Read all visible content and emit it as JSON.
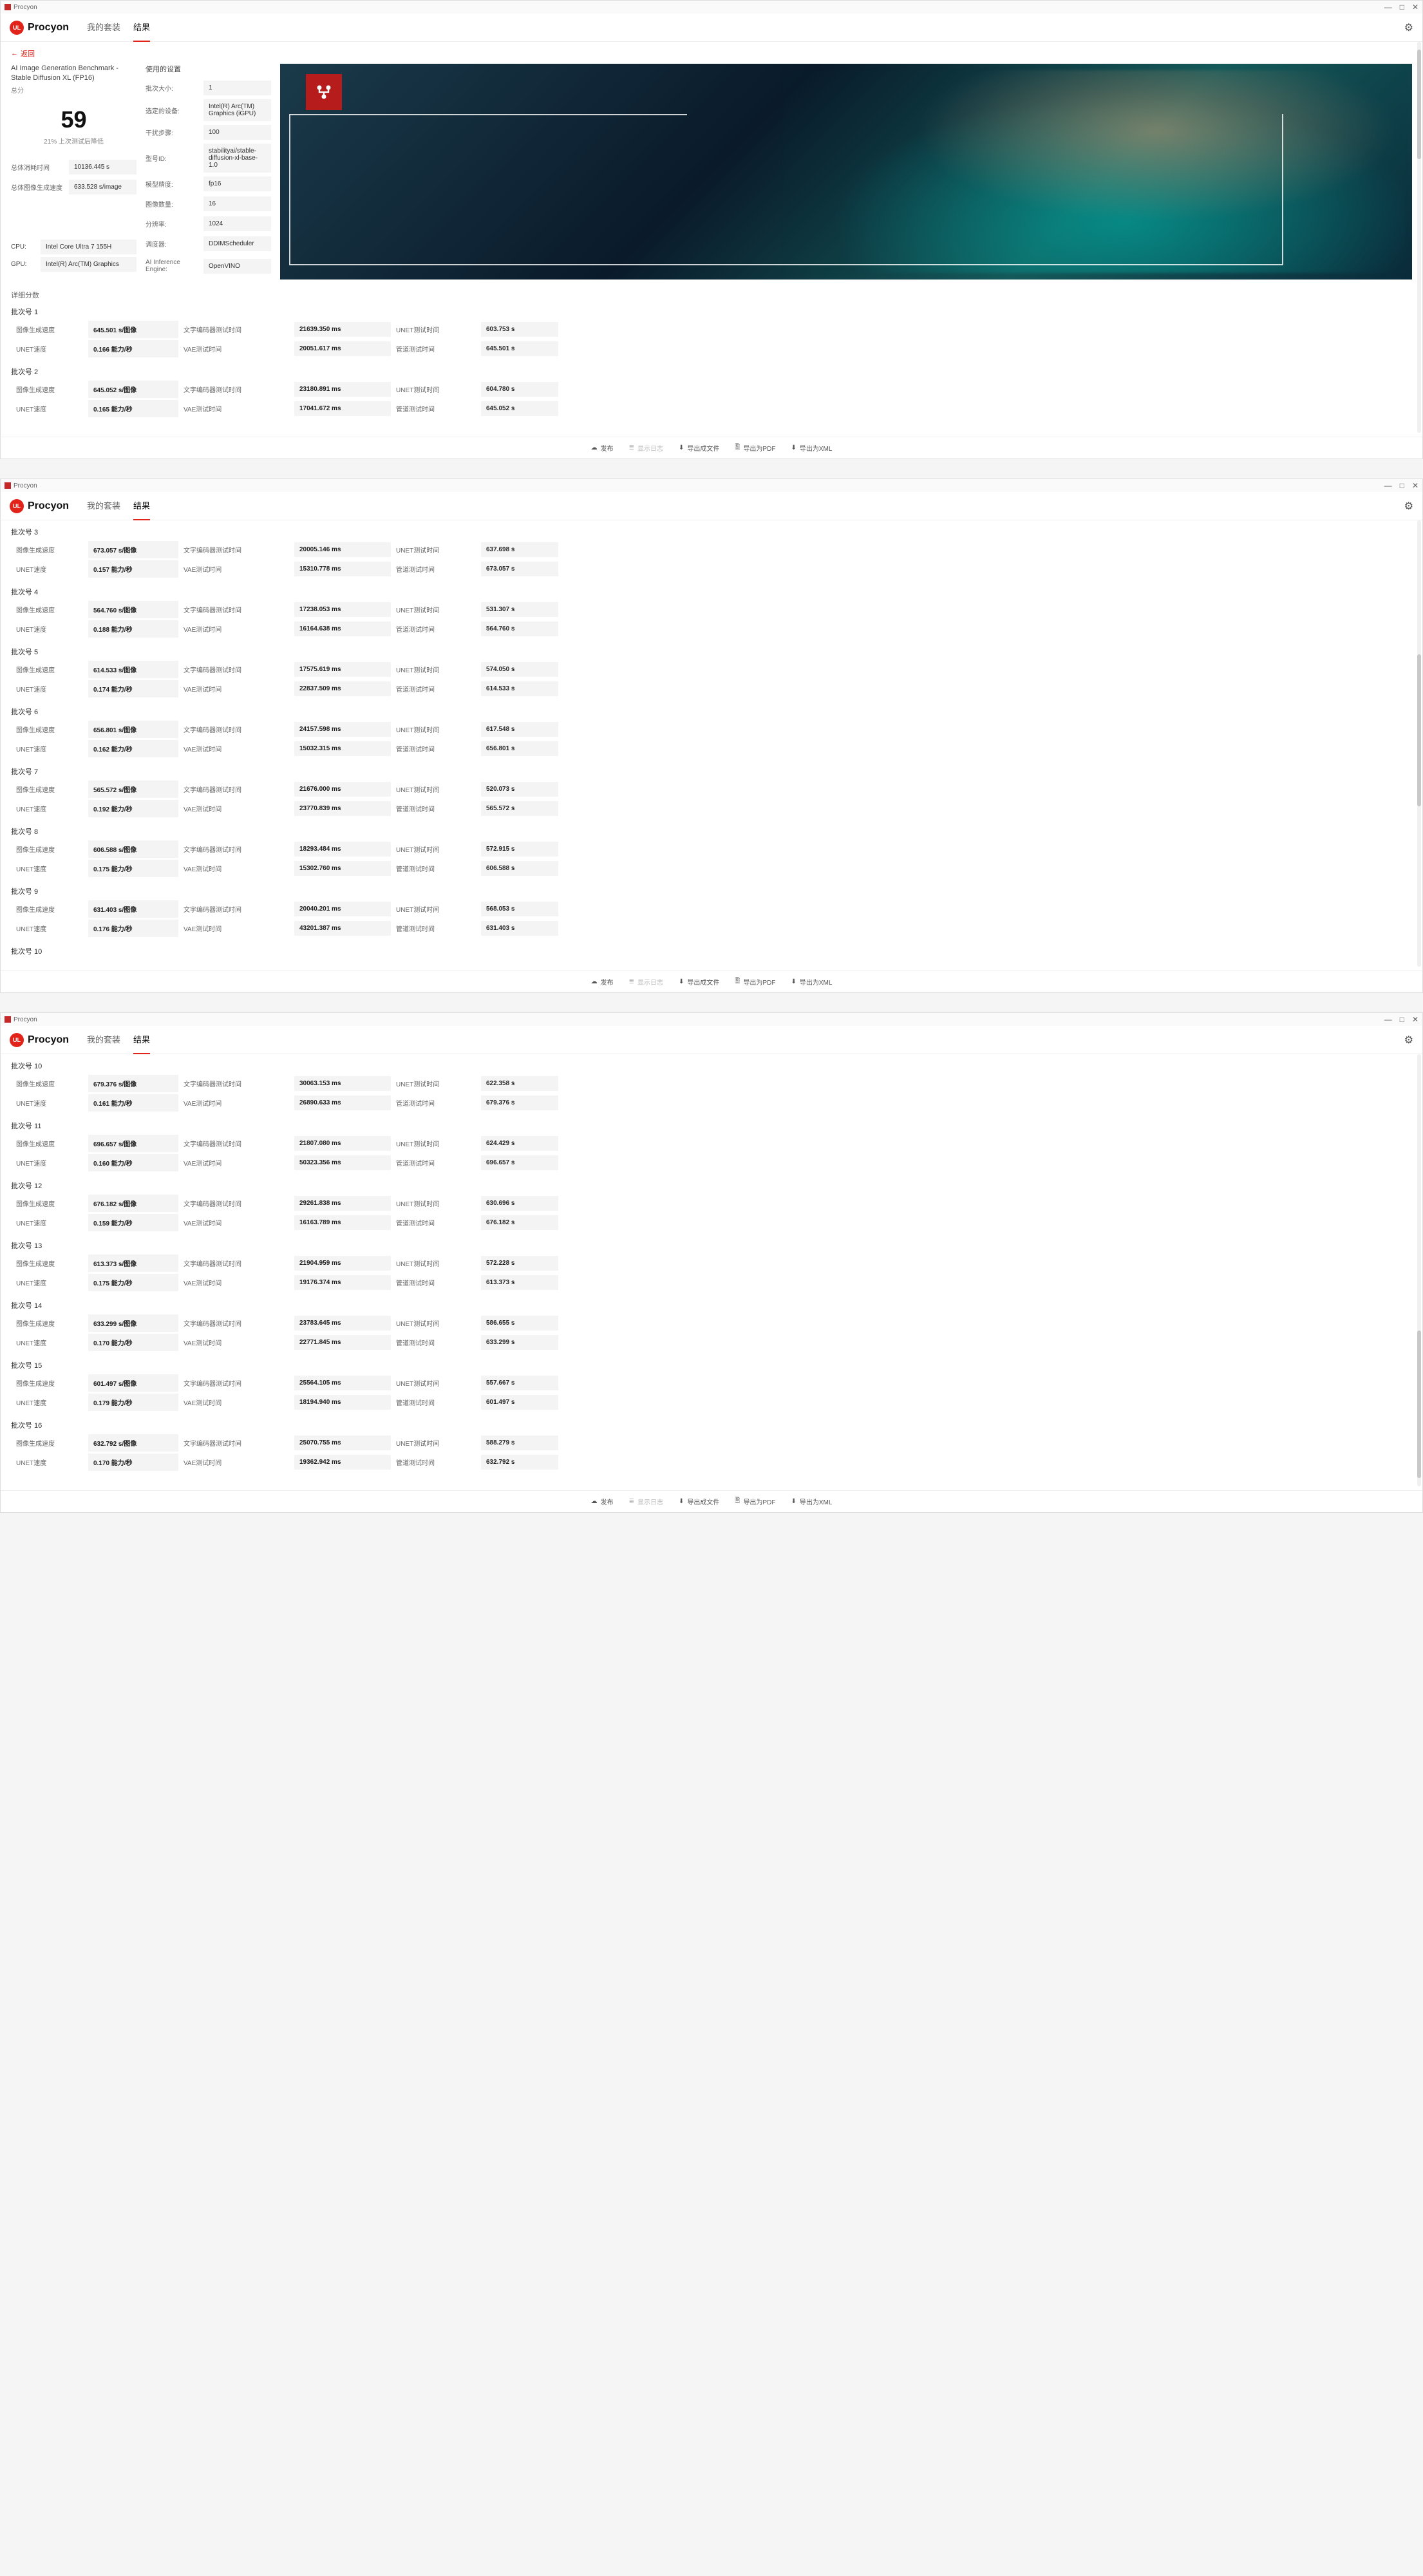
{
  "app": {
    "titlebar": "Procyon",
    "name": "Procyon",
    "logo_badge": "UL"
  },
  "tabs": {
    "my_suites": "我的套装",
    "results": "结果"
  },
  "back": "返回",
  "score": {
    "title": "AI Image Generation Benchmark - Stable Diffusion XL (FP16)",
    "subtitle": "总分",
    "value": "59",
    "note": "21% 上次测试后降低",
    "metrics": [
      {
        "label": "总体消耗时间",
        "value": "10136.445 s"
      },
      {
        "label": "总体图像生成速度",
        "value": "633.528 s/image"
      }
    ],
    "system": [
      {
        "label": "CPU:",
        "value": "Intel Core Ultra 7 155H"
      },
      {
        "label": "GPU:",
        "value": "Intel(R) Arc(TM) Graphics"
      }
    ]
  },
  "settings": {
    "title": "使用的设置",
    "rows": [
      {
        "label": "批次大小:",
        "value": "1"
      },
      {
        "label": "选定的设备:",
        "value": "Intel(R) Arc(TM) Graphics (iGPU)"
      },
      {
        "label": "干扰步骤:",
        "value": "100"
      },
      {
        "label": "型号ID:",
        "value": "stabilityai/stable-diffusion-xl-base-1.0"
      },
      {
        "label": "模型精度:",
        "value": "fp16"
      },
      {
        "label": "图像数量:",
        "value": "16"
      },
      {
        "label": "分辨率:",
        "value": "1024"
      },
      {
        "label": "调度器:",
        "value": "DDIMScheduler"
      },
      {
        "label": "AI Inference Engine:",
        "value": "OpenVINO"
      }
    ]
  },
  "details_title": "详细分数",
  "row_labels": {
    "img_speed": "图像生成速度",
    "unet_speed": "UNET速度",
    "text_enc": "文字编码器测试时间",
    "vae": "VAE测试时间",
    "unet_time": "UNET测试时间",
    "pipe_time": "管道测试时间"
  },
  "batches": [
    {
      "n": "批次号 1",
      "img_speed": "645.501 s/图像",
      "unet_speed": "0.166 能力/秒",
      "text_enc": "21639.350 ms",
      "vae": "20051.617 ms",
      "unet_time": "603.753 s",
      "pipe_time": "645.501 s"
    },
    {
      "n": "批次号 2",
      "img_speed": "645.052 s/图像",
      "unet_speed": "0.165 能力/秒",
      "text_enc": "23180.891 ms",
      "vae": "17041.672 ms",
      "unet_time": "604.780 s",
      "pipe_time": "645.052 s"
    },
    {
      "n": "批次号 3",
      "img_speed": "673.057 s/图像",
      "unet_speed": "0.157 能力/秒",
      "text_enc": "20005.146 ms",
      "vae": "15310.778 ms",
      "unet_time": "637.698 s",
      "pipe_time": "673.057 s"
    },
    {
      "n": "批次号 4",
      "img_speed": "564.760 s/图像",
      "unet_speed": "0.188 能力/秒",
      "text_enc": "17238.053 ms",
      "vae": "16164.638 ms",
      "unet_time": "531.307 s",
      "pipe_time": "564.760 s"
    },
    {
      "n": "批次号 5",
      "img_speed": "614.533 s/图像",
      "unet_speed": "0.174 能力/秒",
      "text_enc": "17575.619 ms",
      "vae": "22837.509 ms",
      "unet_time": "574.050 s",
      "pipe_time": "614.533 s"
    },
    {
      "n": "批次号 6",
      "img_speed": "656.801 s/图像",
      "unet_speed": "0.162 能力/秒",
      "text_enc": "24157.598 ms",
      "vae": "15032.315 ms",
      "unet_time": "617.548 s",
      "pipe_time": "656.801 s"
    },
    {
      "n": "批次号 7",
      "img_speed": "565.572 s/图像",
      "unet_speed": "0.192 能力/秒",
      "text_enc": "21676.000 ms",
      "vae": "23770.839 ms",
      "unet_time": "520.073 s",
      "pipe_time": "565.572 s"
    },
    {
      "n": "批次号 8",
      "img_speed": "606.588 s/图像",
      "unet_speed": "0.175 能力/秒",
      "text_enc": "18293.484 ms",
      "vae": "15302.760 ms",
      "unet_time": "572.915 s",
      "pipe_time": "606.588 s"
    },
    {
      "n": "批次号 9",
      "img_speed": "631.403 s/图像",
      "unet_speed": "0.176 能力/秒",
      "text_enc": "20040.201 ms",
      "vae": "43201.387 ms",
      "unet_time": "568.053 s",
      "pipe_time": "631.403 s"
    },
    {
      "n": "批次号 10",
      "img_speed": "679.376 s/图像",
      "unet_speed": "0.161 能力/秒",
      "text_enc": "30063.153 ms",
      "vae": "26890.633 ms",
      "unet_time": "622.358 s",
      "pipe_time": "679.376 s"
    },
    {
      "n": "批次号 11",
      "img_speed": "696.657 s/图像",
      "unet_speed": "0.160 能力/秒",
      "text_enc": "21807.080 ms",
      "vae": "50323.356 ms",
      "unet_time": "624.429 s",
      "pipe_time": "696.657 s"
    },
    {
      "n": "批次号 12",
      "img_speed": "676.182 s/图像",
      "unet_speed": "0.159 能力/秒",
      "text_enc": "29261.838 ms",
      "vae": "16163.789 ms",
      "unet_time": "630.696 s",
      "pipe_time": "676.182 s"
    },
    {
      "n": "批次号 13",
      "img_speed": "613.373 s/图像",
      "unet_speed": "0.175 能力/秒",
      "text_enc": "21904.959 ms",
      "vae": "19176.374 ms",
      "unet_time": "572.228 s",
      "pipe_time": "613.373 s"
    },
    {
      "n": "批次号 14",
      "img_speed": "633.299 s/图像",
      "unet_speed": "0.170 能力/秒",
      "text_enc": "23783.645 ms",
      "vae": "22771.845 ms",
      "unet_time": "586.655 s",
      "pipe_time": "633.299 s"
    },
    {
      "n": "批次号 15",
      "img_speed": "601.497 s/图像",
      "unet_speed": "0.179 能力/秒",
      "text_enc": "25564.105 ms",
      "vae": "18194.940 ms",
      "unet_time": "557.667 s",
      "pipe_time": "601.497 s"
    },
    {
      "n": "批次号 16",
      "img_speed": "632.792 s/图像",
      "unet_speed": "0.170 能力/秒",
      "text_enc": "25070.755 ms",
      "vae": "19362.942 ms",
      "unet_time": "588.279 s",
      "pipe_time": "632.792 s"
    }
  ],
  "windows": [
    {
      "batch_start": 0,
      "batch_end": 2,
      "show_top": true,
      "extra_title_index": null,
      "thumb_top": "2%",
      "thumb_h": "28%"
    },
    {
      "batch_start": 2,
      "batch_end": 9,
      "show_top": false,
      "extra_title_index": 9,
      "thumb_top": "30%",
      "thumb_h": "34%"
    },
    {
      "batch_start": 9,
      "batch_end": 16,
      "show_top": false,
      "extra_title_index": null,
      "thumb_top": "64%",
      "thumb_h": "34%"
    }
  ],
  "footer": {
    "publish": "发布",
    "show_log": "显示日志",
    "export_file": "导出成文件",
    "export_pdf": "导出为PDF",
    "export_xml": "导出为XML"
  }
}
